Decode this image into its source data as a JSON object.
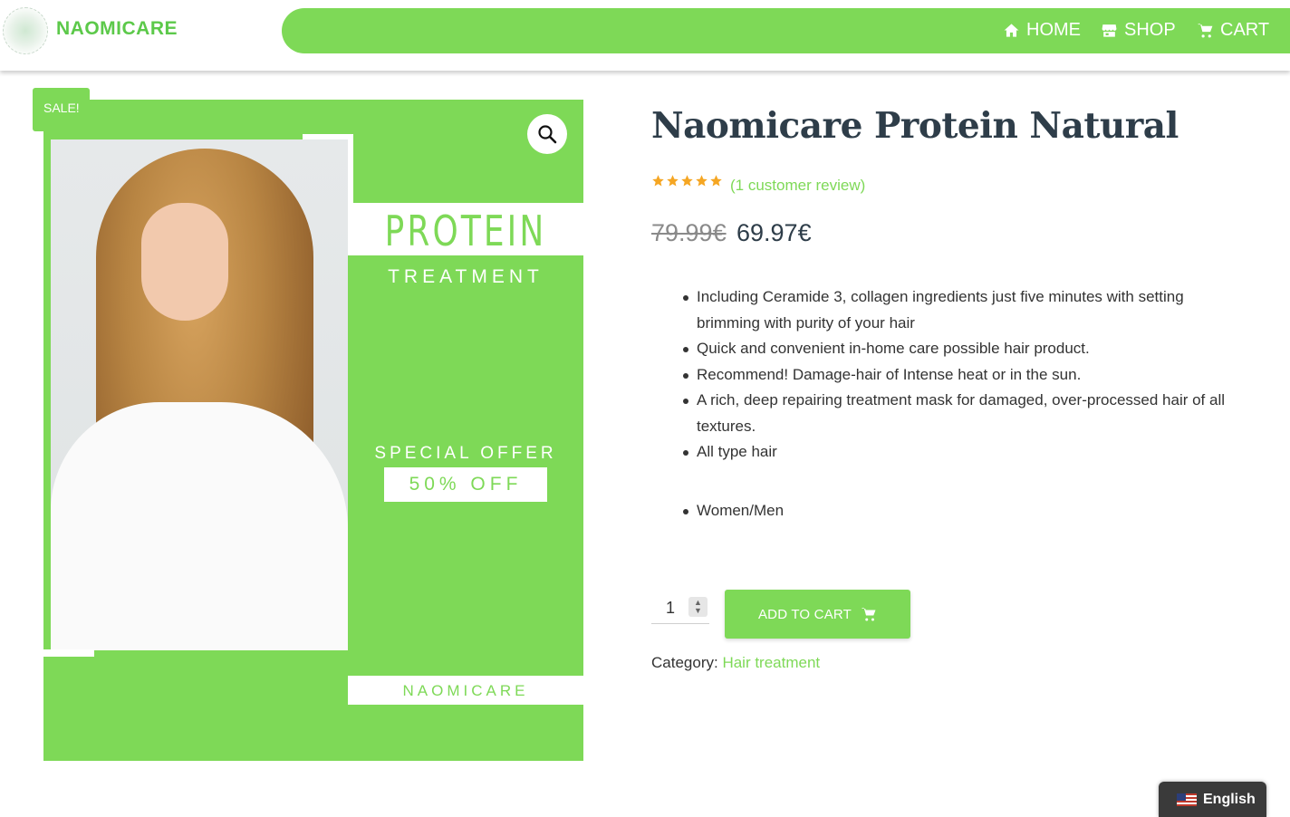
{
  "header": {
    "brand": "NAOMICARE",
    "nav": [
      {
        "label": "HOME",
        "icon": "home-icon"
      },
      {
        "label": "SHOP",
        "icon": "store-icon"
      },
      {
        "label": "CART",
        "icon": "cart-icon"
      }
    ]
  },
  "product": {
    "sale_badge": "SALE!",
    "title": "Naomicare Protein Natural",
    "rating": 5,
    "reviews_label": "(1 customer review)",
    "price_old": "79.99€",
    "price_new": "69.97€",
    "image": {
      "line1": "PROTEIN",
      "line2": "TREATMENT",
      "offer": "SPECIAL OFFER",
      "discount": "50% OFF",
      "brand": "NAOMICARE"
    },
    "features": [
      "Including Ceramide 3, collagen ingredients just five minutes with setting brimming with purity of your hair",
      "Quick and convenient in-home care possible hair product.",
      "Recommend! Damage-hair of Intense heat or in the sun.",
      "A rich, deep repairing treatment mask for damaged, over-processed hair of all textures.",
      "All type hair",
      "Women/Men"
    ],
    "quantity": "1",
    "add_to_cart_label": "ADD TO CART",
    "category_label": "Category:",
    "category_value": "Hair treatment"
  },
  "language": {
    "label": "English",
    "icon": "us-flag-icon"
  },
  "colors": {
    "accent": "#7ed957",
    "title": "#2e3d49",
    "star": "#f5a623"
  }
}
